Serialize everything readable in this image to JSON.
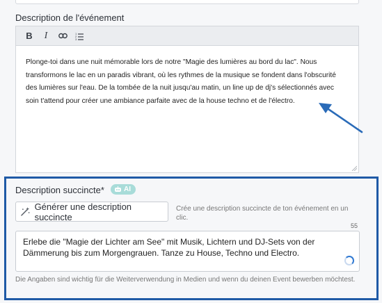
{
  "description": {
    "label": "Description de l'événement",
    "toolbar": {
      "bold": "B",
      "italic": "I",
      "link_icon": "link-icon",
      "list_icon": "numbered-list-icon"
    },
    "text": "Plonge-toi dans une nuit mémorable lors de notre \"Magie des lumières au bord du lac\". Nous transformons le lac en un paradis vibrant, où les rythmes de la musique se fondent dans l'obscurité des lumières sur l'eau. De la tombée de la nuit jusqu'au matin, un line up de dj's sélectionnés avec soin t'attend pour créer une ambiance parfaite avec de la house techno et de l'électro."
  },
  "short_description": {
    "label": "Description succincte*",
    "ai_badge": "AI",
    "generate_button": "Générer une description succincte",
    "generate_hint": "Crée une description succincte de ton événement en un clic.",
    "char_count": "55",
    "value": "Erlebe die \"Magie der Lichter am See\" mit Musik, Lichtern und DJ-Sets von der Dämmerung bis zum Morgengrauen. Tanze zu House, Techno und Electro.",
    "help": "Die Angaben sind wichtig für die Weiterverwendung in Medien und wenn du deinen Event bewerben möchtest."
  },
  "colors": {
    "section_border": "#1f5aa6",
    "arrow": "#2a6bb8",
    "ai_badge": "#a8dcd9"
  }
}
